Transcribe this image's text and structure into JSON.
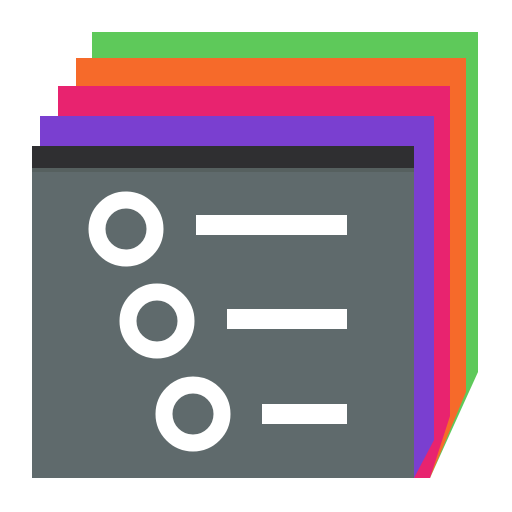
{
  "icon": {
    "name": "stacked-task-list-app-icon",
    "layers": [
      {
        "name": "green",
        "color": "#5ec95a"
      },
      {
        "name": "orange",
        "color": "#f66a2a"
      },
      {
        "name": "pink",
        "color": "#e8236f"
      },
      {
        "name": "purple",
        "color": "#7a3fd0"
      }
    ],
    "front_card": {
      "header_color": "#2f2f31",
      "body_color": "#5f6a6c",
      "item_color": "#ffffff",
      "list_items": 3
    }
  }
}
